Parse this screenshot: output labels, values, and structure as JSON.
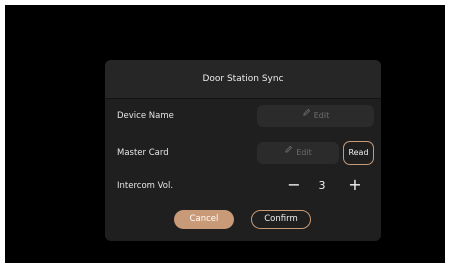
{
  "dialog": {
    "title": "Door Station Sync",
    "cancel_label": "Cancel",
    "confirm_label": "Confirm"
  },
  "device_name": {
    "label": "Device Name",
    "edit_label": "Edit"
  },
  "master_card": {
    "label": "Master Card",
    "edit_label": "Edit",
    "read_label": "Read"
  },
  "intercom_volume": {
    "label": "Intercom Vol.",
    "minus_symbol": "−",
    "plus_symbol": "+",
    "value": "3"
  },
  "icons": {
    "edit": "pencil-icon"
  },
  "colors": {
    "accent": "#c99a78",
    "dialog_bg": "#1f1f1f",
    "field_bg": "#2b2b2b"
  }
}
